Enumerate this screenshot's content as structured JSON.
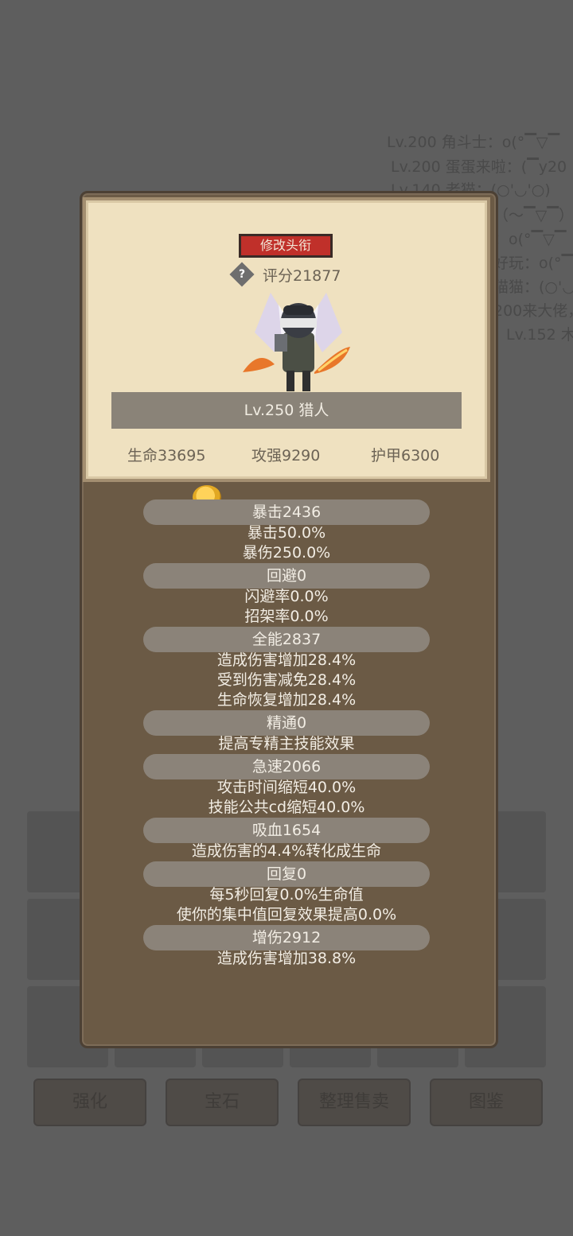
{
  "background": {
    "chat_lines": [
      "Lv.200 角斗士：o(°▔▽▔",
      "Lv.200 蛋蛋来啦：(▔y20",
      "Lv.140 老猫：(○'◡'○)",
      "（～▔▽▔）～",
      "：o(°▔▽▔",
      "好玩：o(°▔",
      "猫猫：(○'◡",
      "200来大佬，",
      "Lv.152 木"
    ],
    "buttons": [
      "强化",
      "宝石",
      "整理售卖",
      "图鉴"
    ]
  },
  "profile": {
    "rename_label": "修改头衔",
    "help_symbol": "?",
    "score": "评分21877",
    "name": "Lv.250 猎人",
    "base_stats": [
      "生命33695",
      "攻强9290",
      "护甲6300"
    ]
  },
  "stats": [
    {
      "head": "暴击2436",
      "subs": [
        "暴击50.0%",
        "暴伤250.0%"
      ]
    },
    {
      "head": "回避0",
      "subs": [
        "闪避率0.0%",
        "招架率0.0%"
      ]
    },
    {
      "head": "全能2837",
      "subs": [
        "造成伤害增加28.4%",
        "受到伤害减免28.4%",
        "生命恢复增加28.4%"
      ]
    },
    {
      "head": "精通0",
      "subs": [
        "提高专精主技能效果"
      ]
    },
    {
      "head": "急速2066",
      "subs": [
        "攻击时间缩短40.0%",
        "技能公共cd缩短40.0%"
      ]
    },
    {
      "head": "吸血1654",
      "subs": [
        "造成伤害的4.4%转化成生命"
      ]
    },
    {
      "head": "回复0",
      "subs": [
        "每5秒回复0.0%生命值",
        "使你的集中值回复效果提高0.0%"
      ]
    },
    {
      "head": "增伤2912",
      "subs": [
        "造成伤害增加38.8%"
      ]
    }
  ],
  "colors": {
    "overlay": "#5e5e5e",
    "panel": "#6b5a45",
    "card": "#efe1c0",
    "rename_button": "#c0302a",
    "stat_pill": "#8b8379"
  }
}
